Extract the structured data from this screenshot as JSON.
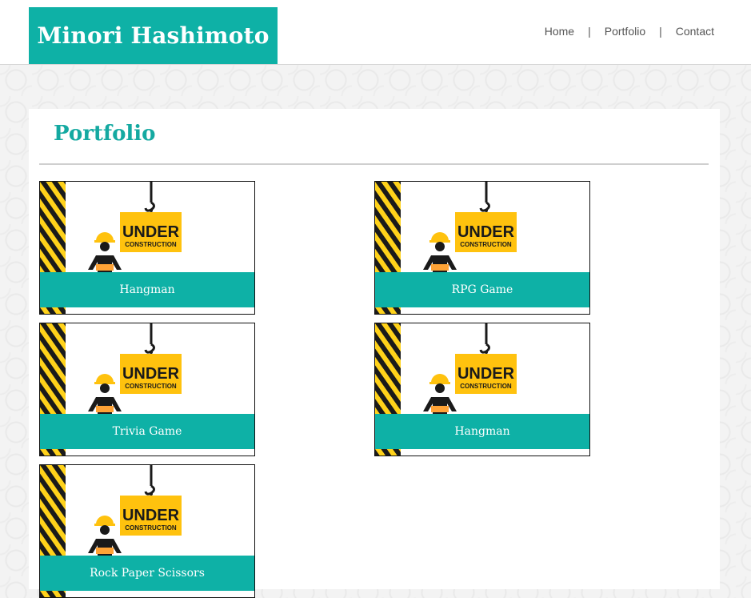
{
  "header": {
    "brand": "Minori Hashimoto",
    "nav": {
      "home": "Home",
      "portfolio": "Portfolio",
      "contact": "Contact",
      "separator": "|"
    }
  },
  "main": {
    "title": "Portfolio",
    "projects": [
      {
        "label": "Hangman",
        "sign_line1": "UNDER",
        "sign_line2": "CONSTRUCTION"
      },
      {
        "label": "RPG Game",
        "sign_line1": "UNDER",
        "sign_line2": "CONSTRUCTION"
      },
      {
        "label": "Trivia Game",
        "sign_line1": "UNDER",
        "sign_line2": "CONSTRUCTION"
      },
      {
        "label": "Hangman",
        "sign_line1": "UNDER",
        "sign_line2": "CONSTRUCTION"
      },
      {
        "label": "Rock Paper Scissors",
        "sign_line1": "UNDER",
        "sign_line2": "CONSTRUCTION"
      }
    ]
  },
  "colors": {
    "accent": "#0eb1a6",
    "title": "#14a9a1",
    "sign": "#ffc20e"
  }
}
